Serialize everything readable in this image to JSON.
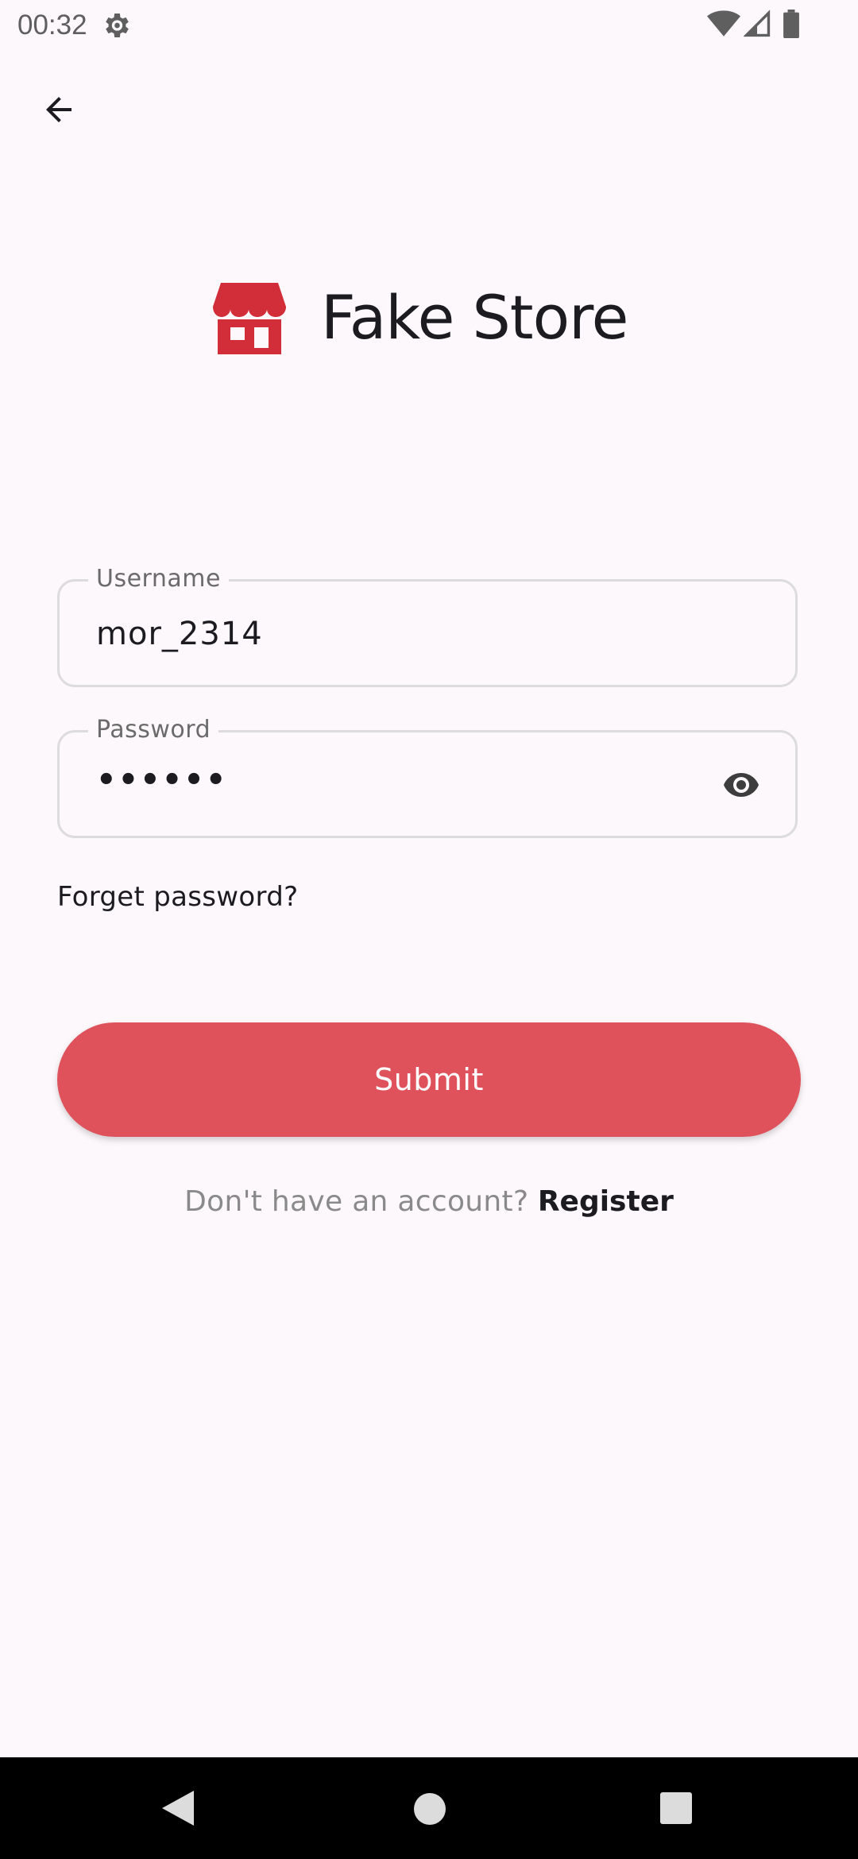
{
  "status_bar": {
    "time": "00:32",
    "icons": [
      "settings-gear-icon",
      "wifi-icon",
      "signal-icon",
      "battery-icon"
    ]
  },
  "header": {
    "back_icon": "arrow-back-icon"
  },
  "logo": {
    "icon": "store-icon",
    "title": "Fake Store",
    "icon_color": "#d12e3a"
  },
  "form": {
    "username": {
      "label": "Username",
      "value": "mor_2314"
    },
    "password": {
      "label": "Password",
      "value": "••••••",
      "toggle_icon": "eye-icon"
    },
    "forgot_label": "Forget password?",
    "submit_label": "Submit",
    "register_prompt": "Don't have an account?",
    "register_link": "Register"
  },
  "colors": {
    "accent": "#df525c",
    "background": "#fdf8fb"
  },
  "nav_bar": {
    "icons": [
      "nav-back-icon",
      "nav-home-icon",
      "nav-recents-icon"
    ]
  }
}
